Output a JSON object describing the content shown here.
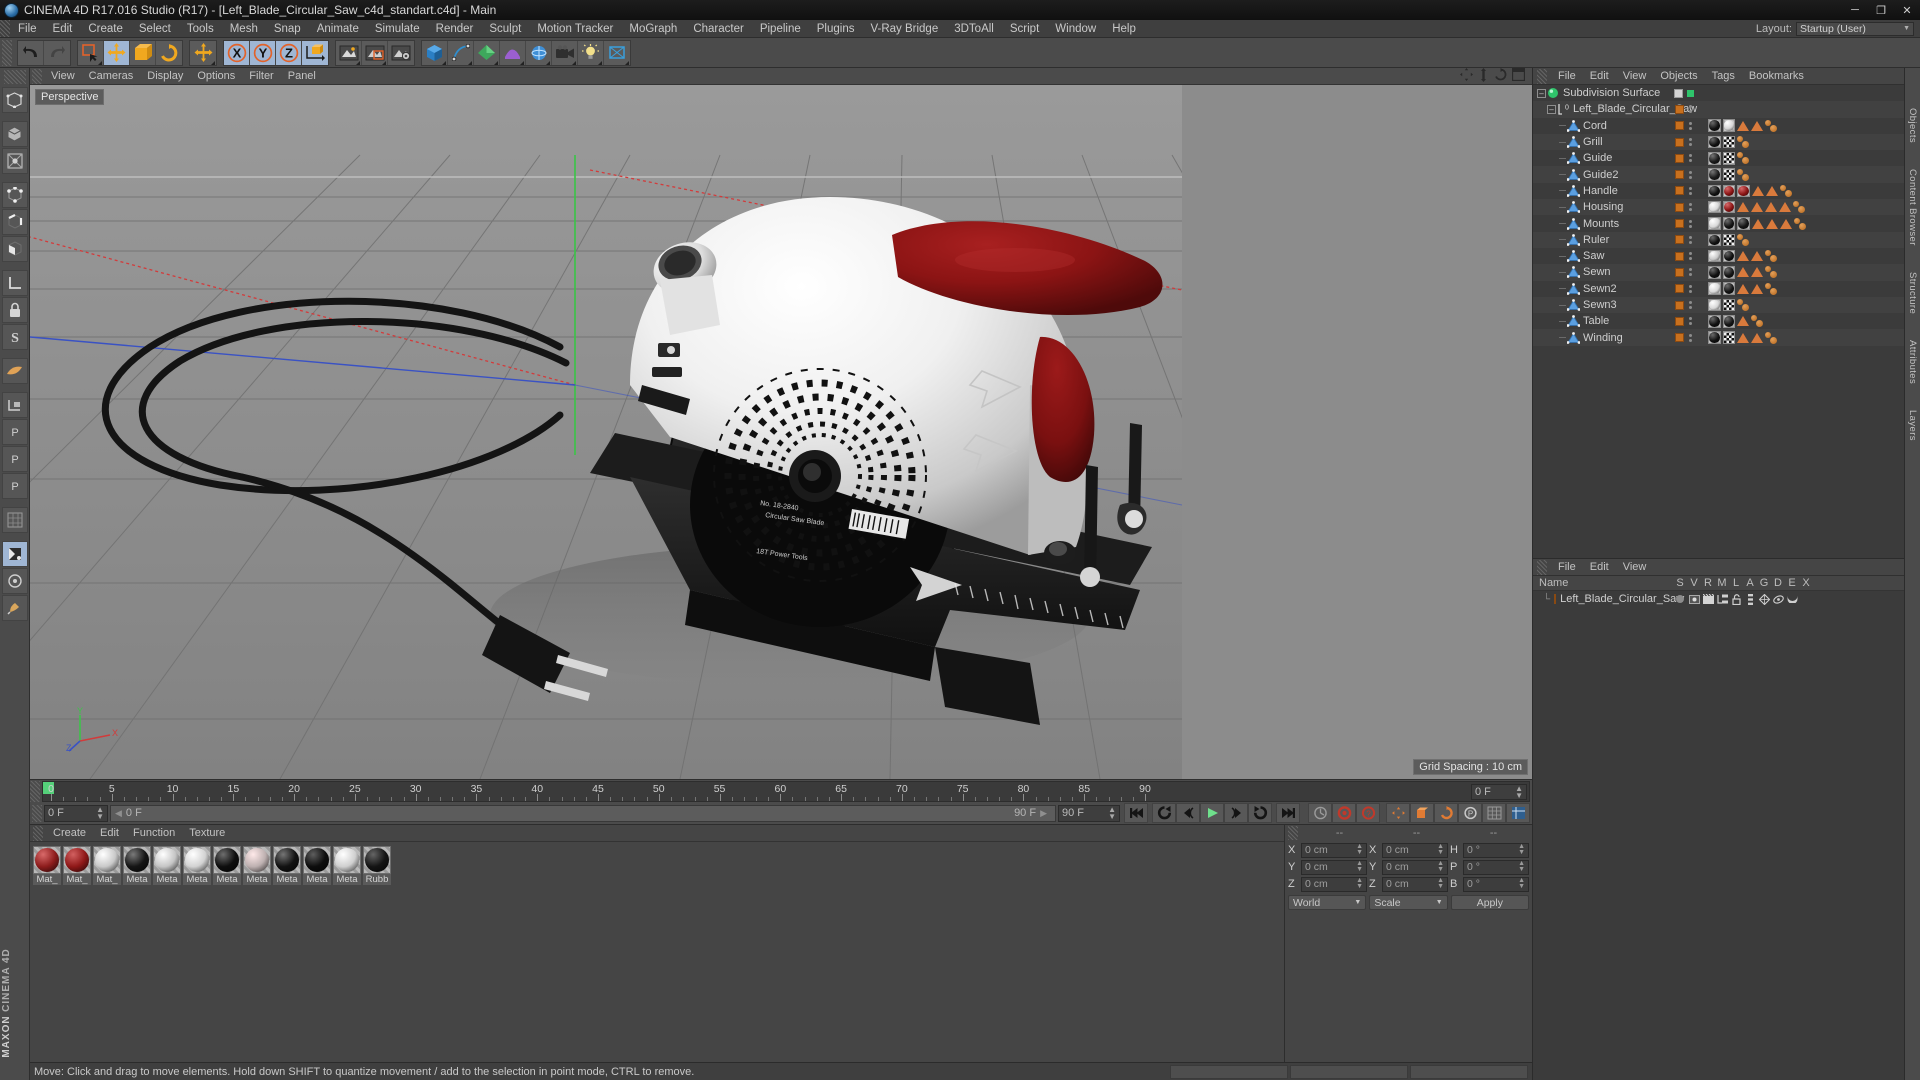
{
  "window": {
    "title": "CINEMA 4D R17.016 Studio (R17) - [Left_Blade_Circular_Saw_c4d_standart.c4d] - Main",
    "minimize": "─",
    "maximize": "❐",
    "close": "✕"
  },
  "menubar": {
    "items": [
      "File",
      "Edit",
      "Create",
      "Select",
      "Tools",
      "Mesh",
      "Snap",
      "Animate",
      "Simulate",
      "Render",
      "Sculpt",
      "Motion Tracker",
      "MoGraph",
      "Character",
      "Pipeline",
      "Plugins",
      "V-Ray Bridge",
      "3DToAll",
      "Script",
      "Window",
      "Help"
    ],
    "layout_label": "Layout:",
    "layout_value": "Startup (User)"
  },
  "viewport": {
    "menu": [
      "View",
      "Cameras",
      "Display",
      "Options",
      "Filter",
      "Panel"
    ],
    "label": "Perspective",
    "grid_spacing": "Grid Spacing : 10 cm",
    "axis_x": "X",
    "axis_y": "Y",
    "axis_z": "Z"
  },
  "timeline": {
    "ticks": [
      {
        "label": "0",
        "pos": 0
      },
      {
        "label": "5",
        "pos": 5
      },
      {
        "label": "10",
        "pos": 10
      },
      {
        "label": "15",
        "pos": 15
      },
      {
        "label": "20",
        "pos": 20
      },
      {
        "label": "25",
        "pos": 25
      },
      {
        "label": "30",
        "pos": 30
      },
      {
        "label": "35",
        "pos": 35
      },
      {
        "label": "40",
        "pos": 40
      },
      {
        "label": "45",
        "pos": 45
      },
      {
        "label": "50",
        "pos": 50
      },
      {
        "label": "55",
        "pos": 55
      },
      {
        "label": "60",
        "pos": 60
      },
      {
        "label": "65",
        "pos": 65
      },
      {
        "label": "70",
        "pos": 70
      },
      {
        "label": "75",
        "pos": 75
      },
      {
        "label": "80",
        "pos": 80
      },
      {
        "label": "85",
        "pos": 85
      },
      {
        "label": "90",
        "pos": 90
      }
    ],
    "current_frame": "0 F",
    "slider_value": "0 F",
    "end_frame_label": "90 F",
    "end_frame_field": "90 F",
    "max_frame": 90,
    "right_frame": "0 F"
  },
  "material_manager": {
    "menu": [
      "Create",
      "Edit",
      "Function",
      "Texture"
    ],
    "materials": [
      {
        "name": "Mat_",
        "color": "#8d1c1c",
        "hi": "#d96a6a"
      },
      {
        "name": "Mat_",
        "color": "#8f1818",
        "hi": "#d26060"
      },
      {
        "name": "Mat_",
        "color": "#c9c9c9",
        "hi": "#ffffff"
      },
      {
        "name": "Meta",
        "color": "#151515",
        "hi": "#7a7a7a"
      },
      {
        "name": "Meta",
        "color": "#c5c5c5",
        "hi": "#ffffff"
      },
      {
        "name": "Meta",
        "color": "#d2d2d2",
        "hi": "#ffffff"
      },
      {
        "name": "Meta",
        "color": "#0e0e0e",
        "hi": "#6e6e6e"
      },
      {
        "name": "Meta",
        "color": "#bdb0b0",
        "hi": "#ffe9e9"
      },
      {
        "name": "Meta",
        "color": "#121212",
        "hi": "#757575"
      },
      {
        "name": "Meta",
        "color": "#0d0d0d",
        "hi": "#5e5e5e"
      },
      {
        "name": "Meta",
        "color": "#cfcfcf",
        "hi": "#ffffff"
      },
      {
        "name": "Rubb",
        "color": "#141414",
        "hi": "#656565"
      }
    ]
  },
  "coordinates": {
    "header": [
      "--",
      "--",
      "--"
    ],
    "rows": [
      {
        "l1": "X",
        "v1": "0 cm",
        "l2": "X",
        "v2": "0 cm",
        "l3": "H",
        "v3": "0 °"
      },
      {
        "l1": "Y",
        "v1": "0 cm",
        "l2": "Y",
        "v2": "0 cm",
        "l3": "P",
        "v3": "0 °"
      },
      {
        "l1": "Z",
        "v1": "0 cm",
        "l2": "Z",
        "v2": "0 cm",
        "l3": "B",
        "v3": "0 °"
      }
    ],
    "world_select": "World",
    "scale_select": "Scale",
    "apply_button": "Apply"
  },
  "object_manager": {
    "menu": [
      "File",
      "Edit",
      "View",
      "Objects",
      "Tags",
      "Bookmarks"
    ],
    "root": {
      "name": "Subdivision Surface",
      "icon": "subdivision-surface-icon"
    },
    "group": {
      "name": "Left_Blade_Circular_Saw",
      "icon": "null-object-icon"
    },
    "objects": [
      {
        "name": "Cord",
        "tags": [
          {
            "t": "ball",
            "c": "#101010",
            "hi": "#6a6a6a"
          },
          {
            "t": "ball",
            "c": "#d4d4d4",
            "hi": "#ffffff"
          },
          {
            "t": "tri"
          },
          {
            "t": "tri"
          },
          {
            "t": "brn"
          }
        ]
      },
      {
        "name": "Grill",
        "tags": [
          {
            "t": "ball",
            "c": "#101010",
            "hi": "#6a6a6a"
          },
          {
            "t": "checker"
          },
          {
            "t": "brn"
          }
        ]
      },
      {
        "name": "Guide",
        "tags": [
          {
            "t": "ball",
            "c": "#1a1a1a",
            "hi": "#767676"
          },
          {
            "t": "checker"
          },
          {
            "t": "brn"
          }
        ]
      },
      {
        "name": "Guide2",
        "tags": [
          {
            "t": "ball",
            "c": "#1a1a1a",
            "hi": "#767676"
          },
          {
            "t": "checker"
          },
          {
            "t": "brn"
          }
        ]
      },
      {
        "name": "Handle",
        "tags": [
          {
            "t": "ball",
            "c": "#101010",
            "hi": "#6a6a6a"
          },
          {
            "t": "ball",
            "c": "#8b1414",
            "hi": "#d86a6a"
          },
          {
            "t": "ball",
            "c": "#8b1414",
            "hi": "#d86a6a"
          },
          {
            "t": "tri"
          },
          {
            "t": "tri"
          },
          {
            "t": "brn"
          }
        ]
      },
      {
        "name": "Housing",
        "tags": [
          {
            "t": "ball",
            "c": "#d8d8d8",
            "hi": "#ffffff"
          },
          {
            "t": "ball",
            "c": "#8b1414",
            "hi": "#d86a6a"
          },
          {
            "t": "tri"
          },
          {
            "t": "tri"
          },
          {
            "t": "tri"
          },
          {
            "t": "tri"
          },
          {
            "t": "brn"
          }
        ]
      },
      {
        "name": "Mounts",
        "tags": [
          {
            "t": "ball",
            "c": "#d8d8d8",
            "hi": "#ffffff"
          },
          {
            "t": "ball",
            "c": "#141414",
            "hi": "#6e6e6e"
          },
          {
            "t": "ball",
            "c": "#141414",
            "hi": "#6e6e6e"
          },
          {
            "t": "tri"
          },
          {
            "t": "tri"
          },
          {
            "t": "tri"
          },
          {
            "t": "brn"
          }
        ]
      },
      {
        "name": "Ruler",
        "tags": [
          {
            "t": "ball",
            "c": "#101010",
            "hi": "#6a6a6a"
          },
          {
            "t": "checker"
          },
          {
            "t": "brn"
          }
        ]
      },
      {
        "name": "Saw",
        "tags": [
          {
            "t": "ball",
            "c": "#c9c9c9",
            "hi": "#ffffff"
          },
          {
            "t": "ball",
            "c": "#101010",
            "hi": "#6a6a6a"
          },
          {
            "t": "tri"
          },
          {
            "t": "tri"
          },
          {
            "t": "brn"
          }
        ]
      },
      {
        "name": "Sewn",
        "tags": [
          {
            "t": "ball",
            "c": "#101010",
            "hi": "#6a6a6a"
          },
          {
            "t": "ball",
            "c": "#141414",
            "hi": "#6e6e6e"
          },
          {
            "t": "tri"
          },
          {
            "t": "tri"
          },
          {
            "t": "brn"
          }
        ]
      },
      {
        "name": "Sewn2",
        "tags": [
          {
            "t": "ball",
            "c": "#d8d8d8",
            "hi": "#ffffff"
          },
          {
            "t": "ball",
            "c": "#141414",
            "hi": "#6e6e6e"
          },
          {
            "t": "tri"
          },
          {
            "t": "tri"
          },
          {
            "t": "brn"
          }
        ]
      },
      {
        "name": "Sewn3",
        "tags": [
          {
            "t": "ball",
            "c": "#d8d8d8",
            "hi": "#ffffff"
          },
          {
            "t": "checker"
          },
          {
            "t": "brn"
          }
        ]
      },
      {
        "name": "Table",
        "tags": [
          {
            "t": "ball",
            "c": "#101010",
            "hi": "#6a6a6a"
          },
          {
            "t": "ball",
            "c": "#141414",
            "hi": "#6e6e6e"
          },
          {
            "t": "tri"
          },
          {
            "t": "brn"
          }
        ]
      },
      {
        "name": "Winding",
        "tags": [
          {
            "t": "ball",
            "c": "#101010",
            "hi": "#6a6a6a"
          },
          {
            "t": "checker"
          },
          {
            "t": "tri"
          },
          {
            "t": "tri"
          },
          {
            "t": "brn"
          }
        ]
      }
    ]
  },
  "layer_manager": {
    "menu": [
      "File",
      "Edit",
      "View"
    ],
    "columns": [
      "Name",
      "S",
      "V",
      "R",
      "M",
      "L",
      "A",
      "G",
      "D",
      "E",
      "X"
    ],
    "layer_name": "Left_Blade_Circular_Saw",
    "layer_color": "#c8701e"
  },
  "right_dock": {
    "tabs": [
      "Objects",
      "Content Browser",
      "Structure",
      "Attributes",
      "Layers"
    ]
  },
  "status": {
    "message": "Move: Click and drag to move elements. Hold down SHIFT to quantize movement / add to the selection in point mode, CTRL to remove."
  },
  "brand": {
    "top": "MAXON",
    "bottom": "CINEMA 4D"
  },
  "colors": {
    "accent_orange": "#d97a3c",
    "panel_bg": "#3b3b3b",
    "toolbar_bg": "#4b4b4b",
    "viewport_bg": "#8c8c8c",
    "active_blue": "#9fb6d4",
    "saw_red": "#8b1414",
    "saw_white": "#e8e8e8"
  }
}
